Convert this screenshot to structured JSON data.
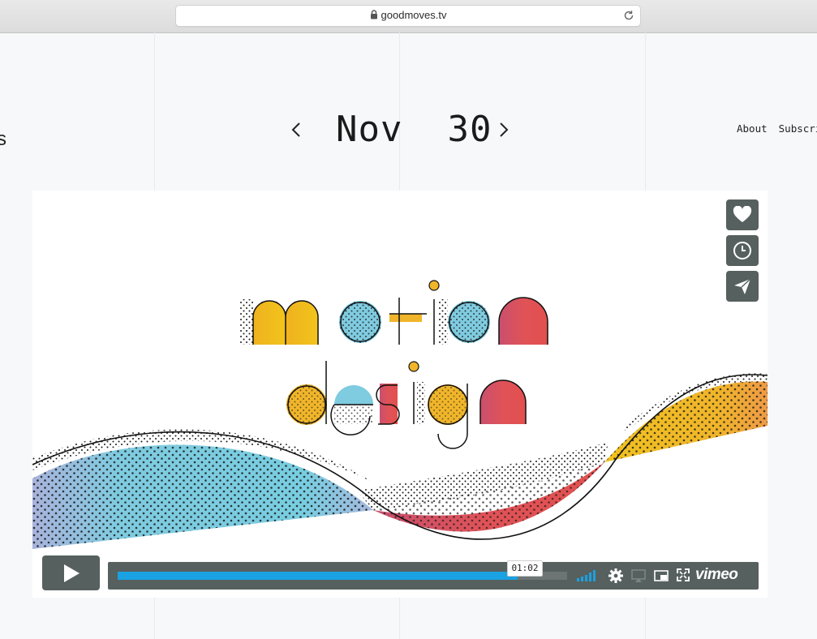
{
  "browser": {
    "url": "goodmoves.tv"
  },
  "site": {
    "logo_partial": "s"
  },
  "date_nav": {
    "month": "Nov",
    "day": "30"
  },
  "nav": {
    "about": "About",
    "subscribe": "Subscri"
  },
  "player": {
    "current_time": "01:02",
    "progress": 0.89,
    "brand": "vimeo",
    "accent": "#1aa1e2"
  },
  "icons": {
    "side": [
      "heart-icon",
      "clock-icon",
      "paper-plane-icon"
    ],
    "controls": [
      "play-icon",
      "volume-bars-icon",
      "gear-icon",
      "airplay-icon",
      "picture-in-picture-icon",
      "fullscreen-icon"
    ]
  }
}
